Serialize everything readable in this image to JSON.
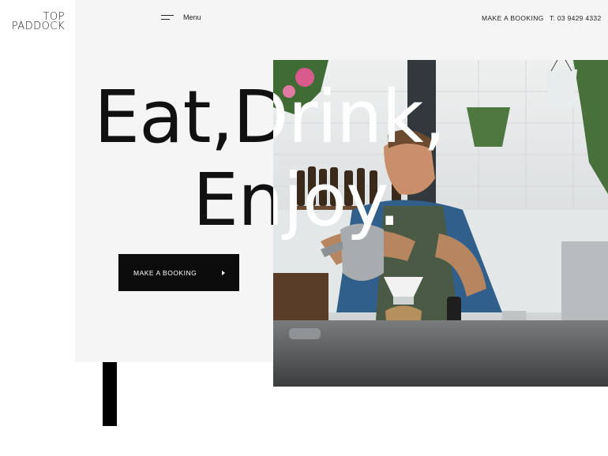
{
  "brand": {
    "line1": "TOP",
    "line2": "PADDOCK"
  },
  "nav": {
    "menu_label": "Menu",
    "booking_label": "MAKE A BOOKING",
    "phone": "T: 03 9429 4332"
  },
  "hero": {
    "line1": "Eat,Drink,",
    "line2": "Enjoy."
  },
  "cta": {
    "label": "MAKE A BOOKING"
  },
  "colors": {
    "text": "#111111",
    "panel": "#f5f5f5",
    "button": "#0c0c0c",
    "button_text": "#ffffff"
  },
  "icons": {
    "menu": "hamburger-icon",
    "cta_arrow": "triangle-right-icon"
  }
}
